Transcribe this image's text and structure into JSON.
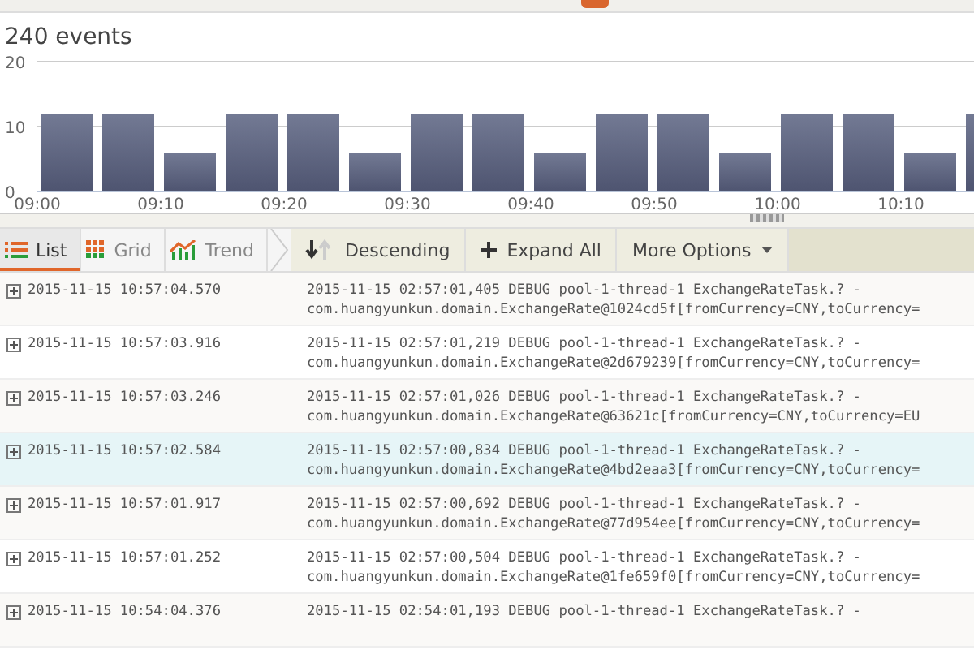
{
  "chart": {
    "title": "240 events",
    "chart_data": {
      "type": "bar",
      "categories": [
        "09:00",
        null,
        "09:10",
        null,
        "09:20",
        null,
        "09:30",
        null,
        "09:40",
        null,
        "09:50",
        null,
        "10:00",
        null,
        "10:10",
        null
      ],
      "values": [
        12,
        12,
        6,
        12,
        12,
        6,
        12,
        12,
        6,
        12,
        12,
        6,
        12,
        12,
        6,
        12
      ],
      "ylim": [
        0,
        20
      ],
      "yticks": [
        0,
        10,
        20
      ]
    }
  },
  "views": [
    {
      "label": "List",
      "kind": "list",
      "selected": true
    },
    {
      "label": "Grid",
      "kind": "grid",
      "selected": false
    },
    {
      "label": "Trend",
      "kind": "trend",
      "selected": false
    }
  ],
  "actions": [
    {
      "label": "Descending",
      "kind": "sort"
    },
    {
      "label": "Expand All",
      "kind": "expand"
    },
    {
      "label": "More Options",
      "kind": "menu"
    }
  ],
  "events": [
    {
      "time": "2015-11-15 10:57:04.570",
      "line_1": "2015-11-15 02:57:01,405 DEBUG pool-1-thread-1 ExchangeRateTask.? -",
      "line_2": "com.huangyunkun.domain.ExchangeRate@1024cd5f[fromCurrency=CNY,toCurrency=",
      "selected": false
    },
    {
      "time": "2015-11-15 10:57:03.916",
      "line_1": "2015-11-15 02:57:01,219 DEBUG pool-1-thread-1 ExchangeRateTask.? -",
      "line_2": "com.huangyunkun.domain.ExchangeRate@2d679239[fromCurrency=CNY,toCurrency=",
      "selected": false
    },
    {
      "time": "2015-11-15 10:57:03.246",
      "line_1": "2015-11-15 02:57:01,026 DEBUG pool-1-thread-1 ExchangeRateTask.? -",
      "line_2": "com.huangyunkun.domain.ExchangeRate@63621c[fromCurrency=CNY,toCurrency=EU",
      "selected": false
    },
    {
      "time": "2015-11-15 10:57:02.584",
      "line_1": "2015-11-15 02:57:00,834 DEBUG pool-1-thread-1 ExchangeRateTask.? -",
      "line_2": "com.huangyunkun.domain.ExchangeRate@4bd2eaa3[fromCurrency=CNY,toCurrency=",
      "selected": true
    },
    {
      "time": "2015-11-15 10:57:01.917",
      "line_1": "2015-11-15 02:57:00,692 DEBUG pool-1-thread-1 ExchangeRateTask.? -",
      "line_2": "com.huangyunkun.domain.ExchangeRate@77d954ee[fromCurrency=CNY,toCurrency=",
      "selected": false
    },
    {
      "time": "2015-11-15 10:57:01.252",
      "line_1": "2015-11-15 02:57:00,504 DEBUG pool-1-thread-1 ExchangeRateTask.? -",
      "line_2": "com.huangyunkun.domain.ExchangeRate@1fe659f0[fromCurrency=CNY,toCurrency=",
      "selected": false
    },
    {
      "time": "2015-11-15 10:54:04.376",
      "line_1": "2015-11-15 02:54:01,193 DEBUG pool-1-thread-1 ExchangeRateTask.? -",
      "selected": false
    }
  ]
}
